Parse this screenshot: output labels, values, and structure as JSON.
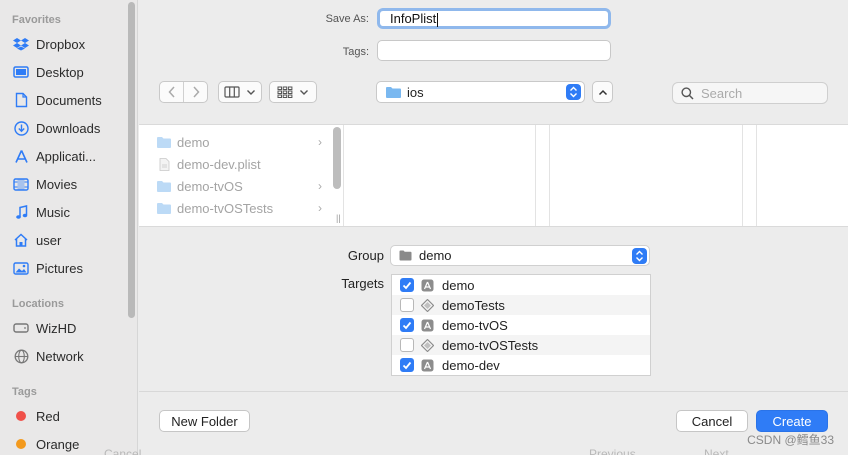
{
  "sidebar": {
    "favorites_heading": "Favorites",
    "favorites": [
      {
        "label": "Dropbox",
        "icon": "dropbox-icon"
      },
      {
        "label": "Desktop",
        "icon": "desktop-icon"
      },
      {
        "label": "Documents",
        "icon": "document-icon"
      },
      {
        "label": "Downloads",
        "icon": "download-icon"
      },
      {
        "label": "Applicati...",
        "icon": "applications-icon"
      },
      {
        "label": "Movies",
        "icon": "film-icon"
      },
      {
        "label": "Music",
        "icon": "music-note-icon"
      },
      {
        "label": "user",
        "icon": "home-icon"
      },
      {
        "label": "Pictures",
        "icon": "photo-icon"
      }
    ],
    "locations_heading": "Locations",
    "locations": [
      {
        "label": "WizHD",
        "icon": "drive-icon"
      },
      {
        "label": "Network",
        "icon": "globe-icon"
      }
    ],
    "tags_heading": "Tags",
    "tags": [
      {
        "label": "Red",
        "color": "#f0514a"
      },
      {
        "label": "Orange",
        "color": "#f39a1e"
      }
    ]
  },
  "form": {
    "save_as_label": "Save As:",
    "save_as_value": "InfoPlist",
    "tags_label": "Tags:",
    "location": "ios",
    "search_placeholder": "Search"
  },
  "browser": {
    "files": [
      {
        "name": "demo",
        "type": "folder",
        "has_children": true
      },
      {
        "name": "demo-dev.plist",
        "type": "file",
        "has_children": false
      },
      {
        "name": "demo-tvOS",
        "type": "folder",
        "has_children": true
      },
      {
        "name": "demo-tvOSTests",
        "type": "folder",
        "has_children": true
      }
    ]
  },
  "options": {
    "group_label": "Group",
    "group_value": "demo",
    "targets_label": "Targets",
    "targets": [
      {
        "name": "demo",
        "checked": true,
        "kind": "app"
      },
      {
        "name": "demoTests",
        "checked": false,
        "kind": "test"
      },
      {
        "name": "demo-tvOS",
        "checked": true,
        "kind": "app"
      },
      {
        "name": "demo-tvOSTests",
        "checked": false,
        "kind": "test"
      },
      {
        "name": "demo-dev",
        "checked": true,
        "kind": "app"
      }
    ]
  },
  "buttons": {
    "new_folder": "New Folder",
    "cancel": "Cancel",
    "create": "Create"
  },
  "background_ghost": {
    "left": "Cancel",
    "mid": "Previous",
    "right": "Next"
  },
  "watermark": "CSDN @鳕鱼33",
  "colors": {
    "accent": "#2f7cf6",
    "folder": "#7ab8f0"
  }
}
